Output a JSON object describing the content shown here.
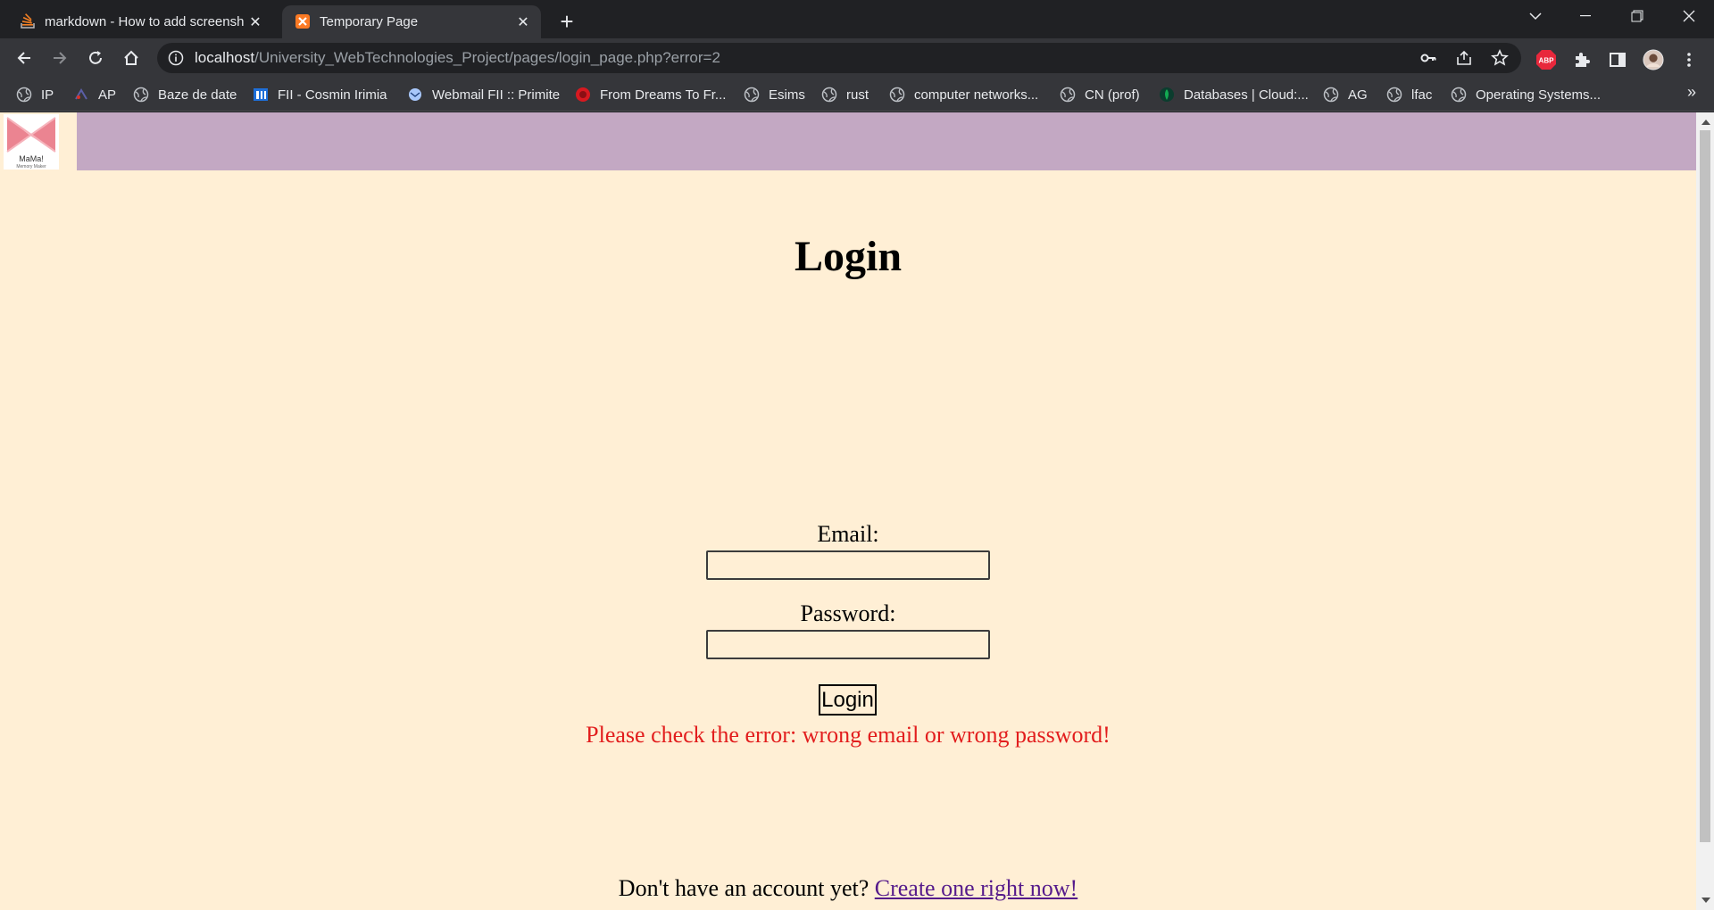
{
  "browser": {
    "tabs": [
      {
        "title": "markdown - How to add screensh",
        "active": false,
        "favicon": "stackoverflow-icon"
      },
      {
        "title": "Temporary Page",
        "active": true,
        "favicon": "xampp-icon"
      }
    ],
    "address": {
      "host": "localhost",
      "path": "/University_WebTechnologies_Project/pages/login_page.php?error=2"
    },
    "bookmarks": [
      {
        "label": "IP",
        "icon": "globe-icon"
      },
      {
        "label": "AP",
        "icon": "ap-icon"
      },
      {
        "label": "Baze de date",
        "icon": "globe-icon"
      },
      {
        "label": "FII - Cosmin Irimia",
        "icon": "fii-icon"
      },
      {
        "label": "Webmail FII :: Primite",
        "icon": "webmail-icon"
      },
      {
        "label": "From Dreams To Fr...",
        "icon": "red-circle-icon"
      },
      {
        "label": "Esims",
        "icon": "globe-icon"
      },
      {
        "label": "rust",
        "icon": "globe-icon"
      },
      {
        "label": "computer networks...",
        "icon": "globe-icon"
      },
      {
        "label": "CN (prof)",
        "icon": "globe-icon"
      },
      {
        "label": "Databases | Cloud:...",
        "icon": "mongodb-leaf-icon"
      },
      {
        "label": "AG",
        "icon": "globe-icon"
      },
      {
        "label": "lfac",
        "icon": "globe-icon"
      },
      {
        "label": "Operating Systems...",
        "icon": "globe-icon"
      }
    ],
    "more_bookmarks": "»",
    "extensions": {
      "adblock_label": "ABP"
    }
  },
  "page": {
    "logo_text": "MaMa!",
    "logo_subtext": "Memory Maker",
    "title": "Login",
    "email_label": "Email:",
    "email_value": "",
    "password_label": "Password:",
    "password_value": "",
    "login_button": "Login",
    "error_message": "Please check the error: wrong email or wrong password!",
    "signup_prompt": "Don't have an account yet?",
    "signup_link": "Create one right now!"
  },
  "colors": {
    "page_background": "#ffefd5",
    "header_bar": "#c3a8c3",
    "error_text": "#e21d1d",
    "link": "#551a8b"
  }
}
